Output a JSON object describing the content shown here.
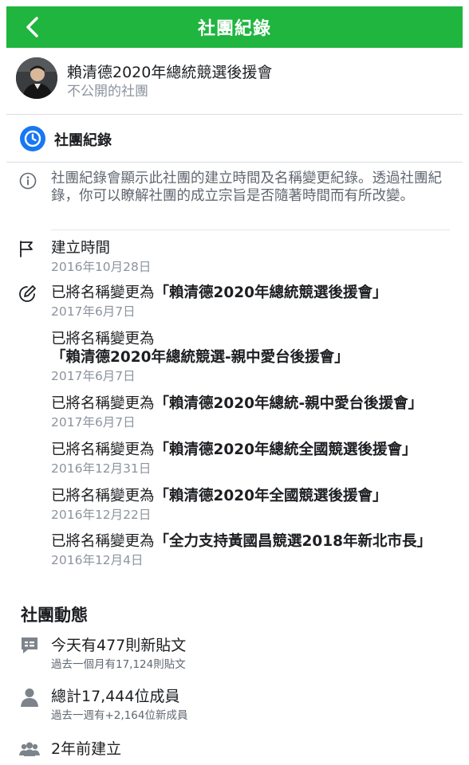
{
  "header": {
    "title": "社團紀錄"
  },
  "group": {
    "name": "賴清德2020年總統競選後援會",
    "privacy": "不公開的社團"
  },
  "section": {
    "title": "社團紀錄"
  },
  "info": {
    "text": "社團紀錄會顯示此社團的建立時間及名稱變更紀錄。透過社團紀錄，你可以瞭解社團的成立宗旨是否隨著時間而有所改變。"
  },
  "created": {
    "label": "建立時間",
    "date": "2016年10月28日"
  },
  "rename_prefix": "已將名稱變更為",
  "renames": [
    {
      "name": "「賴清德2020年總統競選後援會」",
      "date": "2017年6月7日"
    },
    {
      "name": "「賴清德2020年總統競選-親中愛台後援會」",
      "date": "2017年6月7日"
    },
    {
      "name": "「賴清德2020年總統-親中愛台後援會」",
      "date": "2017年6月7日"
    },
    {
      "name": "「賴清德2020年總統全國競選後援會」",
      "date": "2016年12月31日"
    },
    {
      "name": "「賴清德2020年全國競選後援會」",
      "date": "2016年12月22日"
    },
    {
      "name": "「全力支持黃國昌競選2018年新北市長」",
      "date": "2016年12月4日"
    }
  ],
  "activity": {
    "title": "社團動態",
    "posts": {
      "main": "今天有477則新貼文",
      "sub": "過去一個月有17,124則貼文"
    },
    "members": {
      "main": "總計17,444位成員",
      "sub": "過去一週有+2,164位新成員"
    },
    "created": {
      "main": "2年前建立"
    }
  },
  "colors": {
    "header_bg": "#1fb53f",
    "clock_blue": "#1877f2",
    "muted": "#8d949e"
  }
}
